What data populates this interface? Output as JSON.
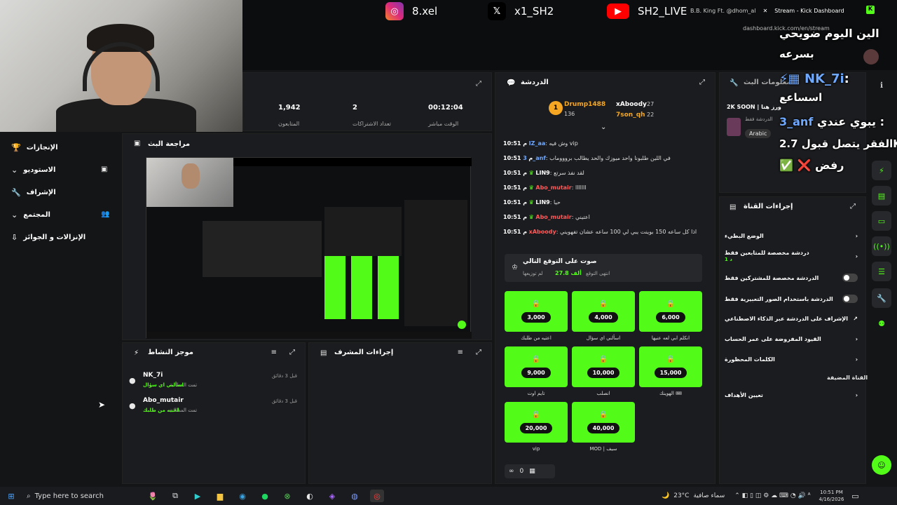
{
  "social": [
    {
      "icon": "instagram-icon",
      "handle": "8.xel",
      "color": "#e1306c"
    },
    {
      "icon": "x-icon",
      "handle": "x1_SH2",
      "color": "#000000"
    },
    {
      "icon": "youtube-icon",
      "handle": "SH2_LIVE",
      "color": "#ff0000"
    }
  ],
  "browser": {
    "tab1": "B.B. King Ft. @dhom_al",
    "tab2": "Stream - Kick Dashboard",
    "url": "dashboard.kick.com/en/stream"
  },
  "overlay": {
    "line1": "الين اليوم ضويحي",
    "line2": "بسرعه",
    "line3_user": "NK_7i",
    "line4": "اسساعع",
    "line5_user": "3_anf",
    "line5_text": "يبوي عندي :",
    "line6": "الفقر يتصل قبول 2.7K",
    "line7": "رفض"
  },
  "stats": {
    "viewers": "1,942",
    "viewers_label": "المتابعون",
    "subs": "2",
    "subs_label": "تعداد الاشتراكات",
    "uptime": "00:12:04",
    "uptime_label": "الوقت مباشر"
  },
  "nav": [
    {
      "label": "الإنجازات",
      "icon": "trophy-icon"
    },
    {
      "label": "الاستوديو",
      "icon": "studio-icon"
    },
    {
      "label": "الإشراف",
      "icon": "wrench-icon"
    },
    {
      "label": "المجتمع",
      "icon": "community-icon"
    },
    {
      "label": "الإنزالات و الجوائز",
      "icon": "drops-icon"
    }
  ],
  "preview": {
    "title": "مراجعة البث"
  },
  "feed": {
    "title": "موجز النشاط",
    "items": [
      {
        "user": "NK_7i",
        "time": "قبل 3 دقائق",
        "text": "تمت المطالبة",
        "reward": "اسألني اي سؤال"
      },
      {
        "user": "Abo_mutair",
        "time": "قبل 3 دقائق",
        "text": "تمت المطالبة",
        "reward": "اعتيه من طلبك"
      }
    ]
  },
  "modactions": {
    "title": "إجراءات المشرف"
  },
  "chat": {
    "title": "الدردشة",
    "top": [
      {
        "user": "Drump1488",
        "count": "136",
        "rank": "1"
      },
      {
        "user": "xAboody",
        "count": "27"
      },
      {
        "user": "7son_qh",
        "count": "22"
      }
    ],
    "messages": [
      {
        "time": "10:51 م",
        "user": "IZ_aa",
        "text": "وش فيه vip",
        "color": "#6ea8ff"
      },
      {
        "time": "10:51 م",
        "user": "3_anf",
        "text": "في اللين طلبونا واحد ميوزك والحد يطالب بروووماب",
        "color": "#6ea8ff"
      },
      {
        "time": "10:51 م",
        "user": "LIN9",
        "text": "لقد نفذ سرتع",
        "color": "#ffffff"
      },
      {
        "time": "10:51 م",
        "user": "Abo_mutair",
        "text": "ااااااا",
        "color": "#ff5a5a"
      },
      {
        "time": "10:51 م",
        "user": "LIN9",
        "text": "حيا",
        "color": "#ffffff"
      },
      {
        "time": "10:51 م",
        "user": "Abo_mutair",
        "text": "اعتيني",
        "color": "#ff5a5a"
      },
      {
        "time": "10:51 م",
        "user": "xAboody",
        "text": "اذا كل ساعه 150 بوينت يبي لي 100 ساعه عشان تفهويني",
        "color": "#ff5a5a"
      }
    ],
    "prediction_title": "صوت على التوقع التالي",
    "prediction_sub": "انتهى التوقع",
    "prediction_amount": "27.8 ألف",
    "prediction_status": "لم توزيعها",
    "rewards": [
      {
        "value": "6,000",
        "label": "انكلم ابي لعه عنيها"
      },
      {
        "value": "4,000",
        "label": "اسألني اي سؤال"
      },
      {
        "value": "3,000",
        "label": "اعتيه من طلبك"
      },
      {
        "value": "15,000",
        "label": "الهوينك 🎟"
      },
      {
        "value": "10,000",
        "label": "انصلب"
      },
      {
        "value": "9,000",
        "label": "تايم اوت"
      },
      {
        "value": "40,000",
        "label": "MOD | سيف"
      },
      {
        "value": "20,000",
        "label": "vip"
      }
    ],
    "footer_count": "0"
  },
  "info": {
    "title": "معلومات البث",
    "stream_title": "2K SOON | ورز هنا",
    "mode": "الدردشة فقط",
    "tag": "Arabic"
  },
  "channel": {
    "title": "إجراءات القناة",
    "rows": [
      {
        "label": "الوضع البطيء",
        "type": "chevron"
      },
      {
        "label": "دردشة مخصصة للمتابعين فقط",
        "sub": "1 د",
        "type": "chevron"
      },
      {
        "label": "الدردشة مخصصة للمشتركين فقط",
        "type": "toggle"
      },
      {
        "label": "الدردشة باستخدام الصور التعبيرية فقط",
        "type": "toggle"
      },
      {
        "label": "الإشراف على الدردشة عبر الذكاء الاصطناعي",
        "type": "external"
      },
      {
        "label": "القيود المفروضة على عمر الحساب",
        "type": "chevron"
      },
      {
        "label": "الكلمات المحظورة",
        "type": "chevron"
      },
      {
        "label": "القناة المضيفة",
        "type": "none"
      },
      {
        "label": "تعيين الأهداف",
        "type": "chevron"
      }
    ]
  },
  "taskbar": {
    "search": "Type here to search",
    "weather": "23°C",
    "weather_text": "سماء صافية",
    "time": "10:51 PM",
    "date": "4/16/2026"
  }
}
